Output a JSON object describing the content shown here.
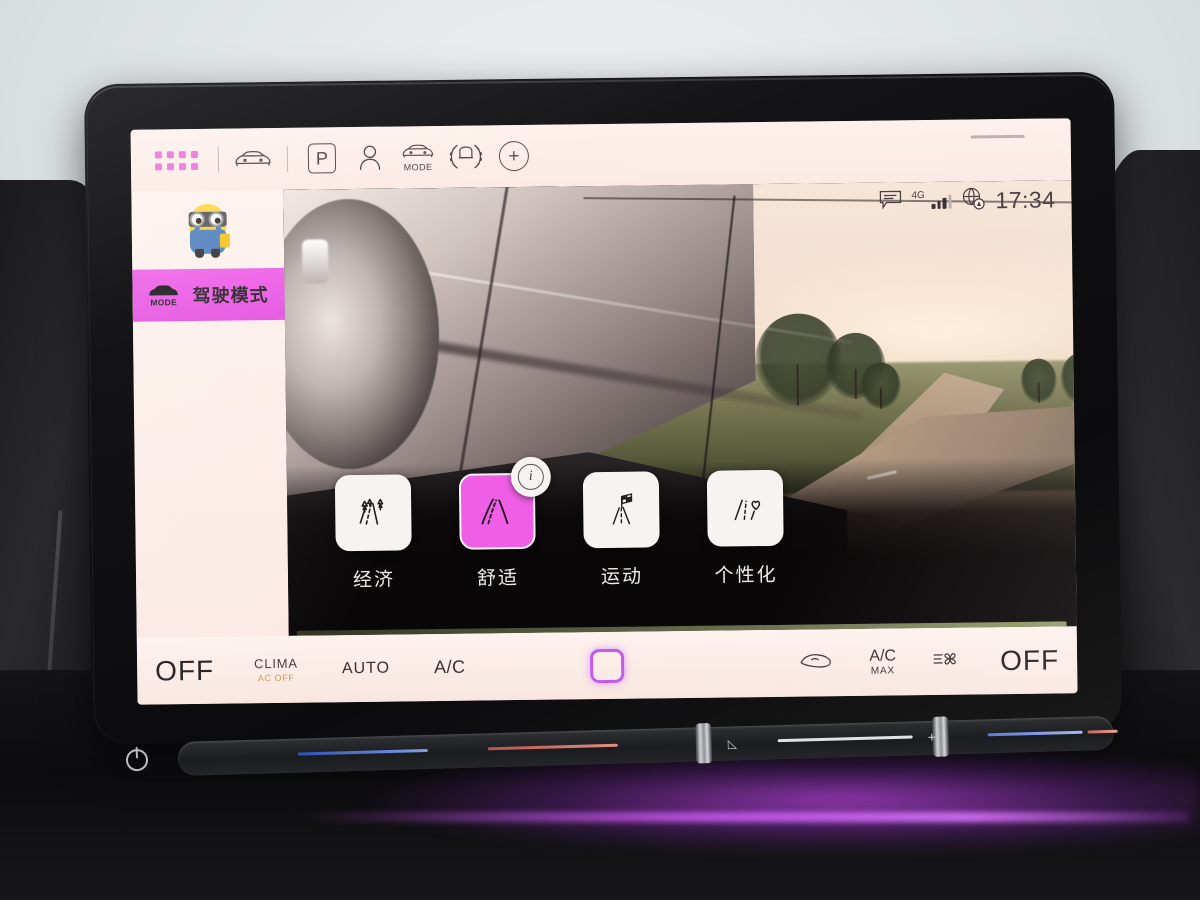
{
  "toolbar": {
    "app_grid_icon": "app-grid-icon",
    "car_icon": "car-front-icon",
    "park_label": "P",
    "profile_icon": "user-profile-icon",
    "drive_mode_icon_label": "MODE",
    "surround_view_icon": "parking-sensor-icon",
    "add_label": "+"
  },
  "statusbar": {
    "message_icon": "message-bubble-icon",
    "network_type": "4G",
    "signal_icon": "signal-bars-icon",
    "globe_icon": "globe-connectivity-icon",
    "time": "17:34"
  },
  "sidebar": {
    "avatar_name": "minion-avatar",
    "items": [
      {
        "label": "驾驶模式",
        "icon_label": "MODE",
        "icon_name": "drive-mode-car-icon",
        "active": true
      }
    ]
  },
  "main": {
    "hero_alt": "car-side-profile-on-country-road",
    "info_badge": "i",
    "modes": [
      {
        "name": "经济",
        "icon": "eco-road-trees-icon",
        "selected": false
      },
      {
        "name": "舒适",
        "icon": "comfort-road-icon",
        "selected": true
      },
      {
        "name": "运动",
        "icon": "sport-checkered-flag-icon",
        "selected": false
      },
      {
        "name": "个性化",
        "icon": "individual-heart-icon",
        "selected": false
      }
    ]
  },
  "climate": {
    "left_off": "OFF",
    "clima_label": "CLIMA",
    "clima_status": "AC OFF",
    "auto_label": "AUTO",
    "ac_label": "A/C",
    "center_button": "climate-home-button",
    "recirculate_icon": "air-recirculation-icon",
    "ac_max_line1": "A/C",
    "ac_max_line2": "MAX",
    "fan_icon": "fan-blower-icon",
    "right_off": "OFF"
  },
  "physical": {
    "power_icon": "power-button-icon",
    "volume_slider": "volume-slider",
    "temp_slider_left": "temperature-slider-left",
    "temp_slider_right": "temperature-slider-right",
    "plus_label": "+"
  },
  "colors": {
    "accent_magenta": "#ef5fe6",
    "screen_bg": "#fbeee9",
    "status_amber": "#cf9a3c",
    "center_button_purple": "#c259f0"
  }
}
